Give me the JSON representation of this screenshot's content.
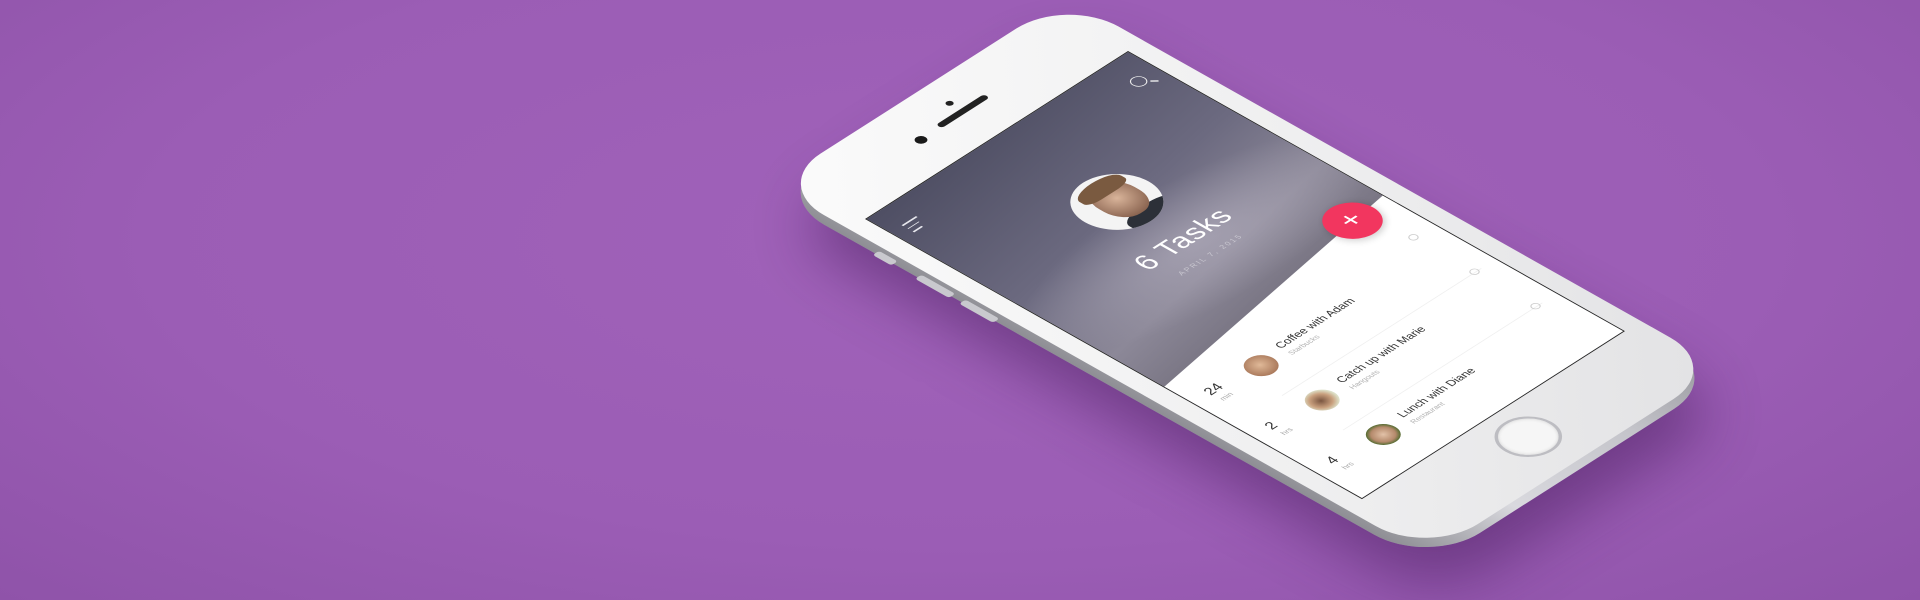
{
  "header": {
    "title": "6 Tasks",
    "date": "APRIL 7, 2015"
  },
  "icons": {
    "menu": "menu-icon",
    "search": "search-icon",
    "add": "plus-icon"
  },
  "fab_label": "+",
  "tasks": [
    {
      "value": "24",
      "unit": "min",
      "title": "Coffee with Adam",
      "subtitle": "Starbucks"
    },
    {
      "value": "2",
      "unit": "hrs",
      "title": "Catch up with Marie",
      "subtitle": "Hangouts"
    },
    {
      "value": "4",
      "unit": "hrs",
      "title": "Lunch with Diane",
      "subtitle": "Restaurant"
    }
  ],
  "colors": {
    "background": "#9b5db5",
    "accent": "#f2365f"
  }
}
